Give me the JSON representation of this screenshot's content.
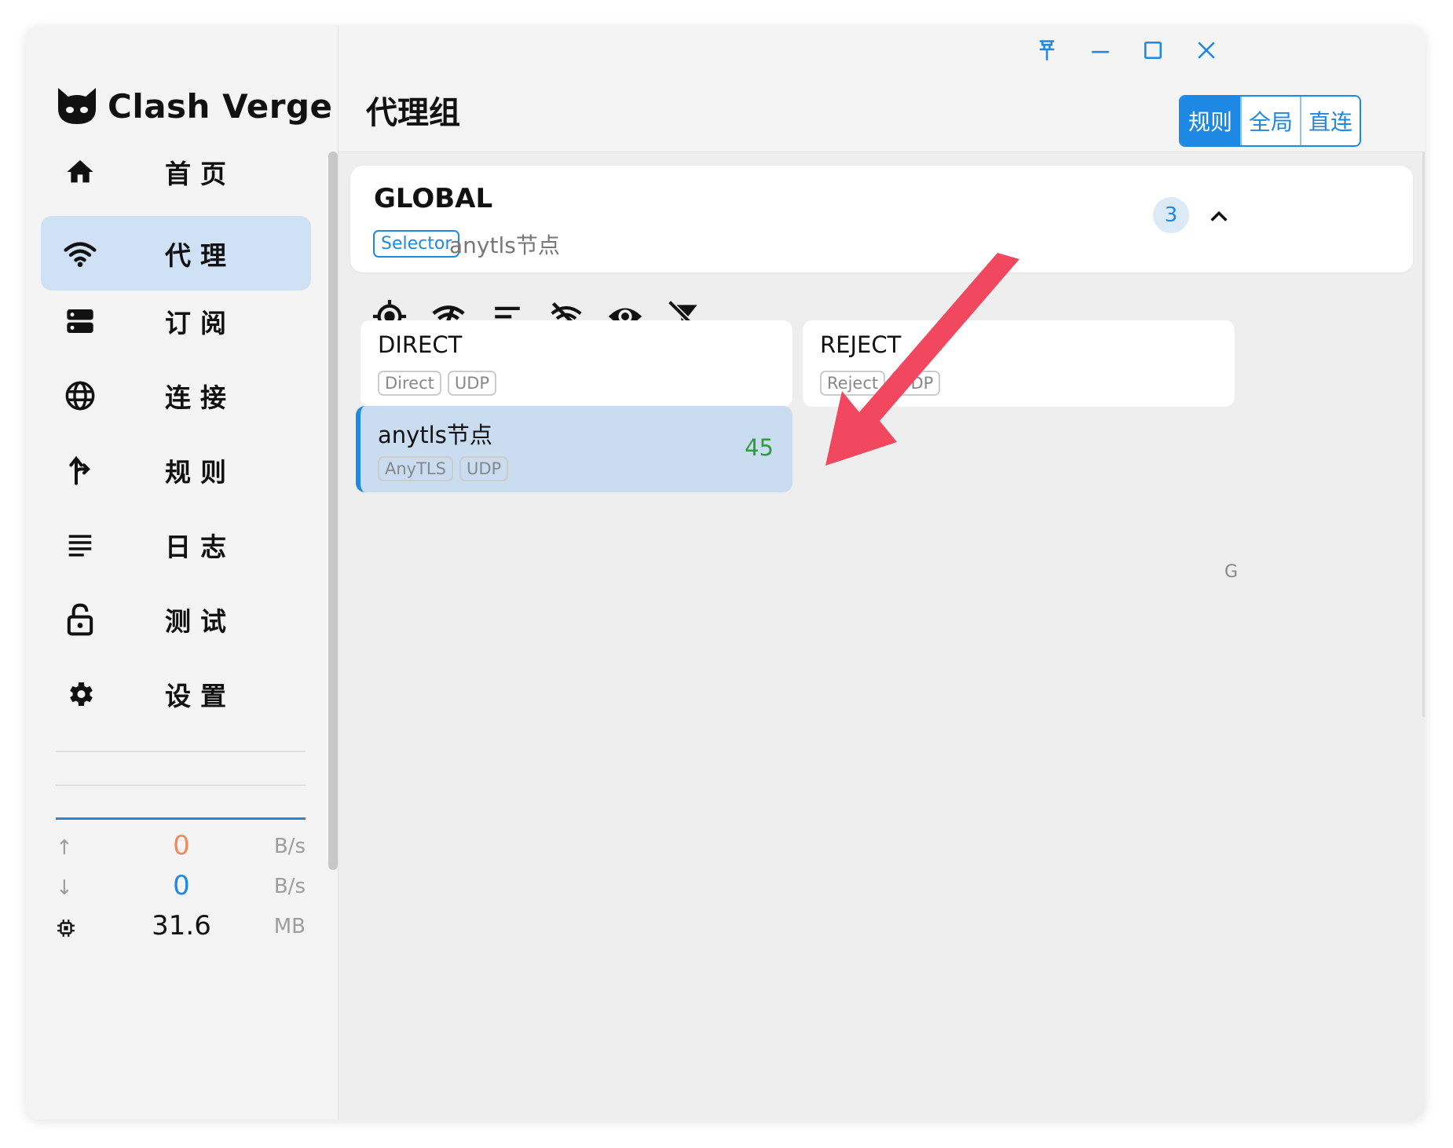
{
  "app": {
    "name": "Clash Verge"
  },
  "nav": [
    {
      "label": "首页",
      "icon": "home-icon",
      "active": false
    },
    {
      "label": "代理",
      "icon": "wifi-icon",
      "active": true
    },
    {
      "label": "订阅",
      "icon": "storage-icon",
      "active": false
    },
    {
      "label": "连接",
      "icon": "globe-icon",
      "active": false
    },
    {
      "label": "规则",
      "icon": "fork-arrow-icon",
      "active": false
    },
    {
      "label": "日志",
      "icon": "list-icon",
      "active": false
    },
    {
      "label": "测试",
      "icon": "lock-open-icon",
      "active": false
    },
    {
      "label": "设置",
      "icon": "gear-icon",
      "active": false
    }
  ],
  "stats": {
    "upload": {
      "value": "0",
      "unit": "B/s",
      "color": "#f08a5d"
    },
    "download": {
      "value": "0",
      "unit": "B/s",
      "color": "#1e88e5"
    },
    "memory": {
      "value": "31.6",
      "unit": "MB"
    }
  },
  "header": {
    "title": "代理组",
    "modes": [
      {
        "label": "规则",
        "active": true
      },
      {
        "label": "全局",
        "active": false
      },
      {
        "label": "直连",
        "active": false
      }
    ]
  },
  "group": {
    "name": "GLOBAL",
    "type": "Selector",
    "now": "anytls节点",
    "count": "3"
  },
  "toolbar": [
    "locate-icon",
    "network-check-icon",
    "sort-icon",
    "hide-delay-icon",
    "visibility-icon",
    "filter-off-icon"
  ],
  "proxies": [
    {
      "name": "DIRECT",
      "tags": [
        "Direct",
        "UDP"
      ],
      "delay": "",
      "selected": false
    },
    {
      "name": "REJECT",
      "tags": [
        "Reject",
        "UDP"
      ],
      "delay": "",
      "selected": false
    },
    {
      "name": "anytls节点",
      "tags": [
        "AnyTLS",
        "UDP"
      ],
      "delay": "45",
      "selected": true
    }
  ],
  "side_letter": "G",
  "colors": {
    "accent": "#1e88e5",
    "selected_bg": "#cfe1f5",
    "delay_ok": "#2e9d3c",
    "annotation_arrow": "#f2485f"
  }
}
